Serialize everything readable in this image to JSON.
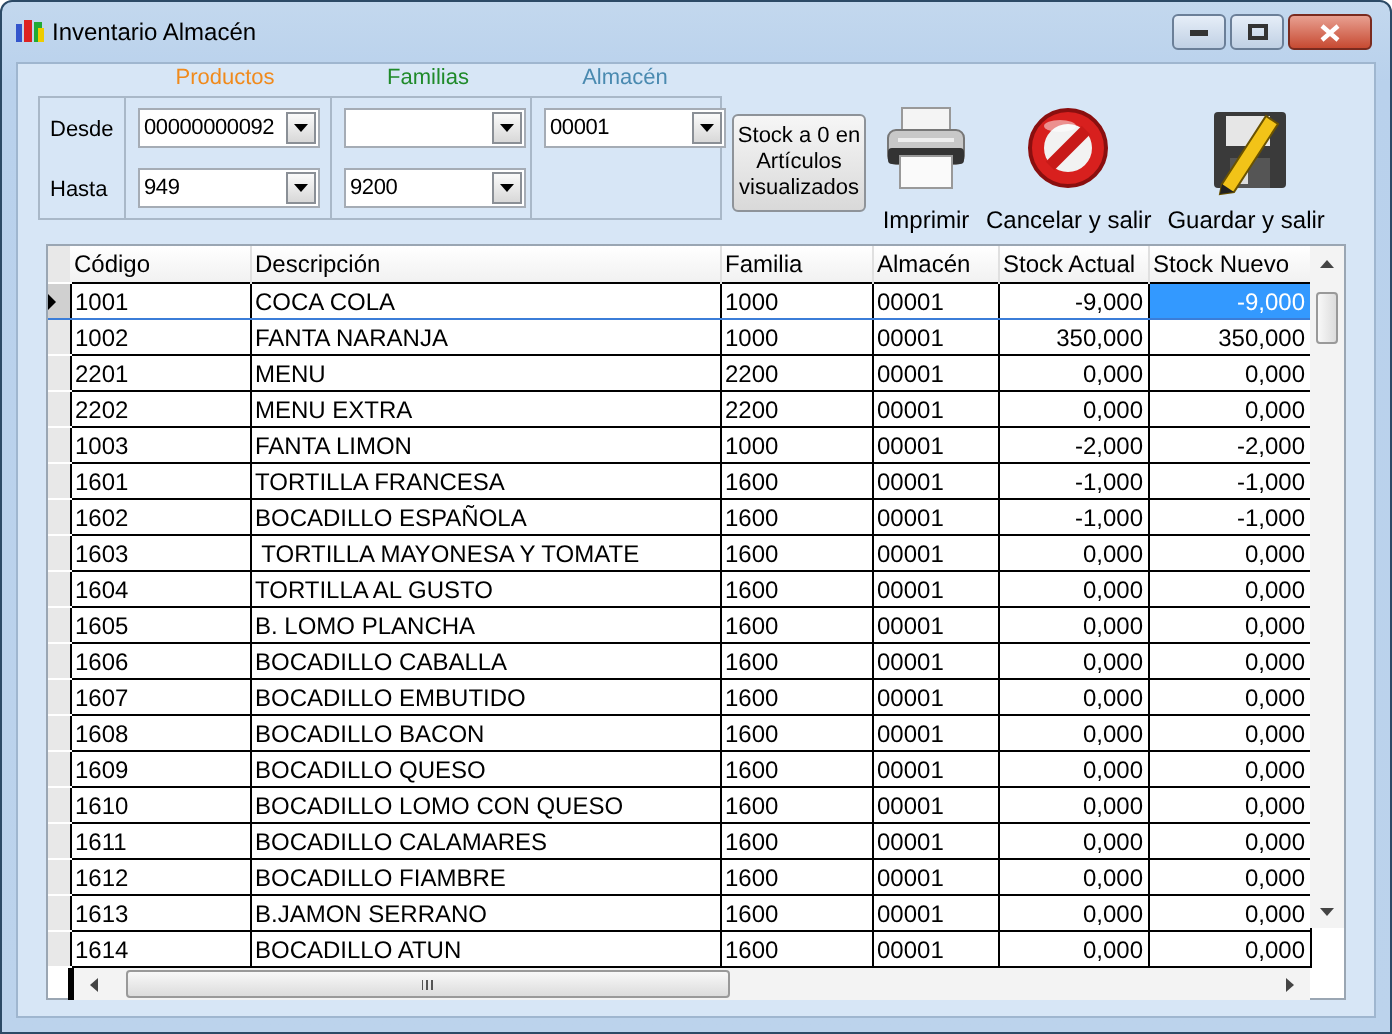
{
  "window": {
    "title": "Inventario Almacén"
  },
  "filters": {
    "row_labels": [
      "Desde",
      "Hasta"
    ],
    "groups": [
      {
        "title": "Productos",
        "color": "#f08a1c",
        "from": "00000000092",
        "to": "949"
      },
      {
        "title": "Familias",
        "color": "#1f8a2a",
        "to": "9200"
      },
      {
        "title": "Almacén",
        "color": "#4a8ab0",
        "from": "00001"
      }
    ]
  },
  "toolbar": {
    "stock_button": "Stock a 0 en Artículos visualizados",
    "actions": [
      {
        "kind": "print",
        "label": "Imprimir"
      },
      {
        "kind": "cancel",
        "label": "Cancelar y salir"
      },
      {
        "kind": "save",
        "label": "Guardar y salir"
      }
    ]
  },
  "table": {
    "columns": [
      {
        "label": "Código",
        "kind": "text"
      },
      {
        "label": "Descripción",
        "kind": "text"
      },
      {
        "label": "Familia",
        "kind": "text"
      },
      {
        "label": "Almacén",
        "kind": "text"
      },
      {
        "label": "Stock Actual",
        "kind": "number"
      },
      {
        "label": "Stock Nuevo",
        "kind": "number"
      }
    ],
    "rows": [
      {
        "selected": true,
        "cells": [
          "1001",
          "COCA COLA",
          "1000",
          "00001",
          "-9,000",
          "-9,000"
        ]
      },
      {
        "selected": false,
        "cells": [
          "1002",
          "FANTA NARANJA",
          "1000",
          "00001",
          "350,000",
          "350,000"
        ]
      },
      {
        "selected": false,
        "cells": [
          "2201",
          "MENU",
          "2200",
          "00001",
          "0,000",
          "0,000"
        ]
      },
      {
        "selected": false,
        "cells": [
          "2202",
          "MENU EXTRA",
          "2200",
          "00001",
          "0,000",
          "0,000"
        ]
      },
      {
        "selected": false,
        "cells": [
          "1003",
          "FANTA LIMON",
          "1000",
          "00001",
          "-2,000",
          "-2,000"
        ]
      },
      {
        "selected": false,
        "cells": [
          "1601",
          "TORTILLA FRANCESA",
          "1600",
          "00001",
          "-1,000",
          "-1,000"
        ]
      },
      {
        "selected": false,
        "cells": [
          "1602",
          "BOCADILLO ESPAÑOLA",
          "1600",
          "00001",
          "-1,000",
          "-1,000"
        ]
      },
      {
        "selected": false,
        "cells": [
          "1603",
          " TORTILLA MAYONESA Y TOMATE",
          "1600",
          "00001",
          "0,000",
          "0,000"
        ]
      },
      {
        "selected": false,
        "cells": [
          "1604",
          "TORTILLA AL GUSTO",
          "1600",
          "00001",
          "0,000",
          "0,000"
        ]
      },
      {
        "selected": false,
        "cells": [
          "1605",
          "B. LOMO PLANCHA",
          "1600",
          "00001",
          "0,000",
          "0,000"
        ]
      },
      {
        "selected": false,
        "cells": [
          "1606",
          "BOCADILLO CABALLA",
          "1600",
          "00001",
          "0,000",
          "0,000"
        ]
      },
      {
        "selected": false,
        "cells": [
          "1607",
          "BOCADILLO EMBUTIDO",
          "1600",
          "00001",
          "0,000",
          "0,000"
        ]
      },
      {
        "selected": false,
        "cells": [
          "1608",
          "BOCADILLO BACON",
          "1600",
          "00001",
          "0,000",
          "0,000"
        ]
      },
      {
        "selected": false,
        "cells": [
          "1609",
          "BOCADILLO QUESO",
          "1600",
          "00001",
          "0,000",
          "0,000"
        ]
      },
      {
        "selected": false,
        "cells": [
          "1610",
          "BOCADILLO LOMO CON QUESO",
          "1600",
          "00001",
          "0,000",
          "0,000"
        ]
      },
      {
        "selected": false,
        "cells": [
          "1611",
          "BOCADILLO CALAMARES",
          "1600",
          "00001",
          "0,000",
          "0,000"
        ]
      },
      {
        "selected": false,
        "cells": [
          "1612",
          "BOCADILLO FIAMBRE",
          "1600",
          "00001",
          "0,000",
          "0,000"
        ]
      },
      {
        "selected": false,
        "cells": [
          "1613",
          "B.JAMON SERRANO",
          "1600",
          "00001",
          "0,000",
          "0,000"
        ]
      },
      {
        "selected": false,
        "cells": [
          "1614",
          "BOCADILLO ATUN",
          "1600",
          "00001",
          "0,000",
          "0,000"
        ]
      }
    ]
  }
}
